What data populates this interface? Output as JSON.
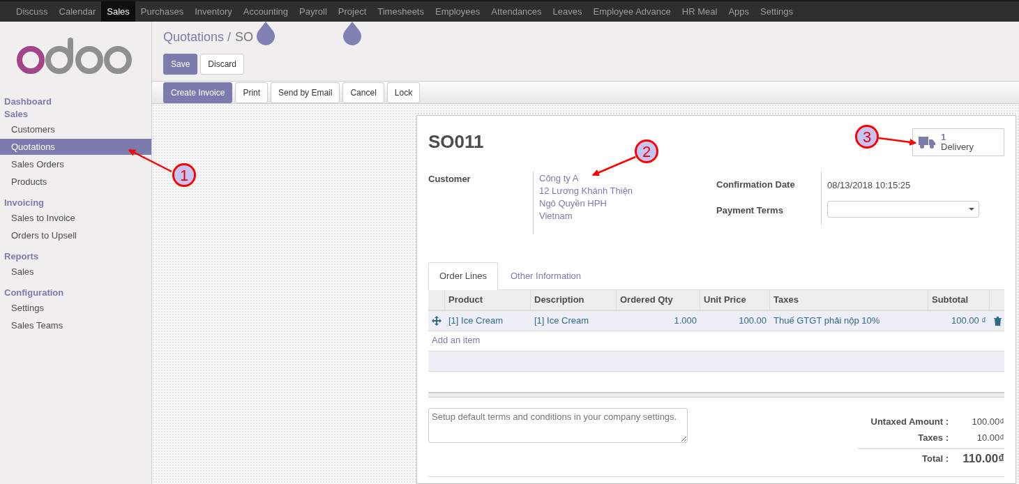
{
  "top_menu": [
    {
      "label": "Discuss",
      "selected": false
    },
    {
      "label": "Calendar",
      "selected": false
    },
    {
      "label": "Sales",
      "selected": true
    },
    {
      "label": "Purchases",
      "selected": false
    },
    {
      "label": "Inventory",
      "selected": false
    },
    {
      "label": "Accounting",
      "selected": false
    },
    {
      "label": "Payroll",
      "selected": false
    },
    {
      "label": "Project",
      "selected": false
    },
    {
      "label": "Timesheets",
      "selected": false
    },
    {
      "label": "Employees",
      "selected": false
    },
    {
      "label": "Attendances",
      "selected": false
    },
    {
      "label": "Leaves",
      "selected": false
    },
    {
      "label": "Employee Advance",
      "selected": false
    },
    {
      "label": "HR Meal",
      "selected": false
    },
    {
      "label": "Apps",
      "selected": false
    },
    {
      "label": "Settings",
      "selected": false
    }
  ],
  "sidebar": {
    "items": [
      {
        "kind": "section",
        "label": "Dashboard",
        "selected": false
      },
      {
        "kind": "section",
        "label": "Sales",
        "selected": false
      },
      {
        "kind": "item",
        "label": "Customers",
        "selected": false
      },
      {
        "kind": "item",
        "label": "Quotations",
        "selected": true
      },
      {
        "kind": "item",
        "label": "Sales Orders",
        "selected": false
      },
      {
        "kind": "item",
        "label": "Products",
        "selected": false
      },
      {
        "kind": "section",
        "label": "Invoicing",
        "selected": false
      },
      {
        "kind": "item",
        "label": "Sales to Invoice",
        "selected": false
      },
      {
        "kind": "item",
        "label": "Orders to Upsell",
        "selected": false
      },
      {
        "kind": "section",
        "label": "Reports",
        "selected": false
      },
      {
        "kind": "item",
        "label": "Sales",
        "selected": false
      },
      {
        "kind": "section",
        "label": "Configuration",
        "selected": false
      },
      {
        "kind": "item",
        "label": "Settings",
        "selected": false
      },
      {
        "kind": "item",
        "label": "Sales Teams",
        "selected": false
      }
    ]
  },
  "breadcrumb": {
    "parent": "Quotations /",
    "current": "SO"
  },
  "edit_buttons": [
    {
      "label": "Save",
      "primary": true
    },
    {
      "label": "Discard",
      "primary": false
    }
  ],
  "action_buttons": [
    {
      "label": "Create Invoice",
      "primary": true
    },
    {
      "label": "Print",
      "primary": false
    },
    {
      "label": "Send by Email",
      "primary": false
    },
    {
      "label": "Cancel",
      "primary": false
    },
    {
      "label": "Lock",
      "primary": false
    }
  ],
  "form": {
    "title": "SO011",
    "smart_button": {
      "count": "1",
      "label": "Delivery"
    },
    "customer_label": "Customer",
    "customer_lines": [
      "Công ty A",
      "12 Lương Khánh Thiện",
      "Ngô Quyền HPH",
      "Vietnam"
    ],
    "confirmation_date_label": "Confirmation Date",
    "confirmation_date": "08/13/2018 10:15:25",
    "payment_terms_label": "Payment Terms",
    "tabs": [
      {
        "label": "Order Lines",
        "selected": true
      },
      {
        "label": "Other Information",
        "selected": false
      }
    ],
    "table": {
      "columns": [
        "Product",
        "Description",
        "Ordered Qty",
        "Unit Price",
        "Taxes",
        "Subtotal"
      ],
      "rows": [
        [
          "[1] Ice Cream",
          "[1] Ice Cream",
          "1.000",
          "100.00",
          "Thuế GTGT phải nộp 10%",
          "100.00 ₫"
        ]
      ],
      "add_item": "Add an item"
    },
    "terms_placeholder": "Setup default terms and conditions in your company settings.",
    "totals": [
      {
        "label": "Untaxed Amount :",
        "value": "100.00₫",
        "grand": false
      },
      {
        "label": "Taxes :",
        "value": "10.00₫",
        "grand": false
      },
      {
        "label": "Total :",
        "value": "110.00₫",
        "grand": true
      }
    ]
  },
  "annotations": [
    {
      "label": "1"
    },
    {
      "label": "2"
    },
    {
      "label": "3"
    }
  ]
}
